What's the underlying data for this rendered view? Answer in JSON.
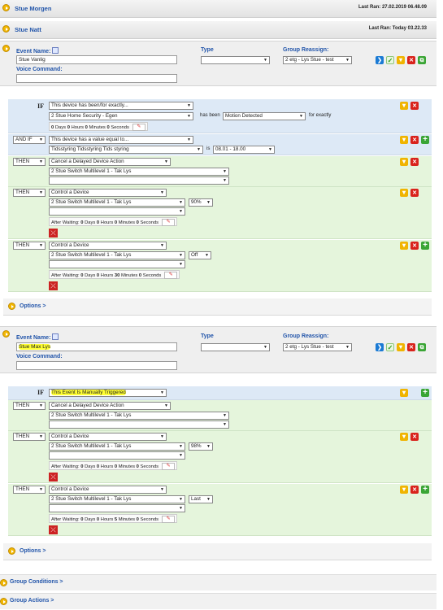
{
  "events_collapsed": [
    {
      "title": "Stue Morgen",
      "last_ran": "Last Ran: 27.02.2019 06.48.09"
    },
    {
      "title": "Stue Natt",
      "last_ran": "Last Ran: Today 03.22.33"
    }
  ],
  "labels": {
    "event_name": "Event Name:",
    "voice_command": "Voice Command:",
    "type": "Type",
    "group_reassign": "Group Reassign:",
    "options": "Options >",
    "after_waiting": "After Waiting:",
    "days": "Days",
    "hours": "Hours",
    "minutes": "Minutes",
    "seconds": "Seconds",
    "has_been": "has been",
    "for_exactly": "for exactly",
    "is": "is",
    "if": "IF",
    "pencil": "✎"
  },
  "event1": {
    "name": "Stue Vanlig",
    "type": "",
    "group": "2 etg - Lys Stue - test",
    "if": {
      "condition": "This device has been/for exactly...",
      "device": "2 Stue Home Security - Egen",
      "state": "Motion Detected",
      "days": "0",
      "hours": "0",
      "minutes": "0",
      "seconds": "0"
    },
    "andif": {
      "op": "AND IF",
      "condition": "This device has a value equal to...",
      "device": "Tidsstyring Tidsstyring Tids styring",
      "value": "08.01 - 18.00"
    },
    "then1": {
      "op": "THEN",
      "action": "Cancel a Delayed Device Action",
      "device": "2 Stue Switch Multilevel 1 - Tak Lys"
    },
    "then2": {
      "op": "THEN",
      "action": "Control a Device",
      "device": "2 Stue Switch Multilevel 1 - Tak Lys",
      "level": "90%",
      "days": "0",
      "hours": "0",
      "minutes": "0",
      "seconds": "0"
    },
    "then3": {
      "op": "THEN",
      "action": "Control a Device",
      "device": "2 Stue Switch Multilevel 1 - Tak Lys",
      "level": "Off",
      "days": "0",
      "hours": "0",
      "minutes": "30",
      "seconds": "0"
    }
  },
  "event2": {
    "name": "Stue Max Lys",
    "type": "",
    "group": "2 etg - Lys Stue - test",
    "if": {
      "condition": "This Event Is Manually Triggered"
    },
    "then1": {
      "op": "THEN",
      "action": "Cancel a Delayed Device Action",
      "device": "2 Stue Switch Multilevel 1 - Tak Lys"
    },
    "then2": {
      "op": "THEN",
      "action": "Control a Device",
      "device": "2 Stue Switch Multilevel 1 - Tak Lys",
      "level": "98%",
      "days": "0",
      "hours": "0",
      "minutes": "0",
      "seconds": "0"
    },
    "then3": {
      "op": "THEN",
      "action": "Control a Device",
      "device": "2 Stue Switch Multilevel 1 - Tak Lys",
      "level": "Last",
      "days": "0",
      "hours": "0",
      "minutes": "5",
      "seconds": "0"
    }
  },
  "group_conditions": "Group Conditions >",
  "group_actions": "Group Actions >",
  "colors": {
    "accent": "#2255aa",
    "bullet": "#f2b600",
    "if_row": "#dde9f6",
    "then_row": "#e5f5dc",
    "highlight": "#ffff33"
  }
}
